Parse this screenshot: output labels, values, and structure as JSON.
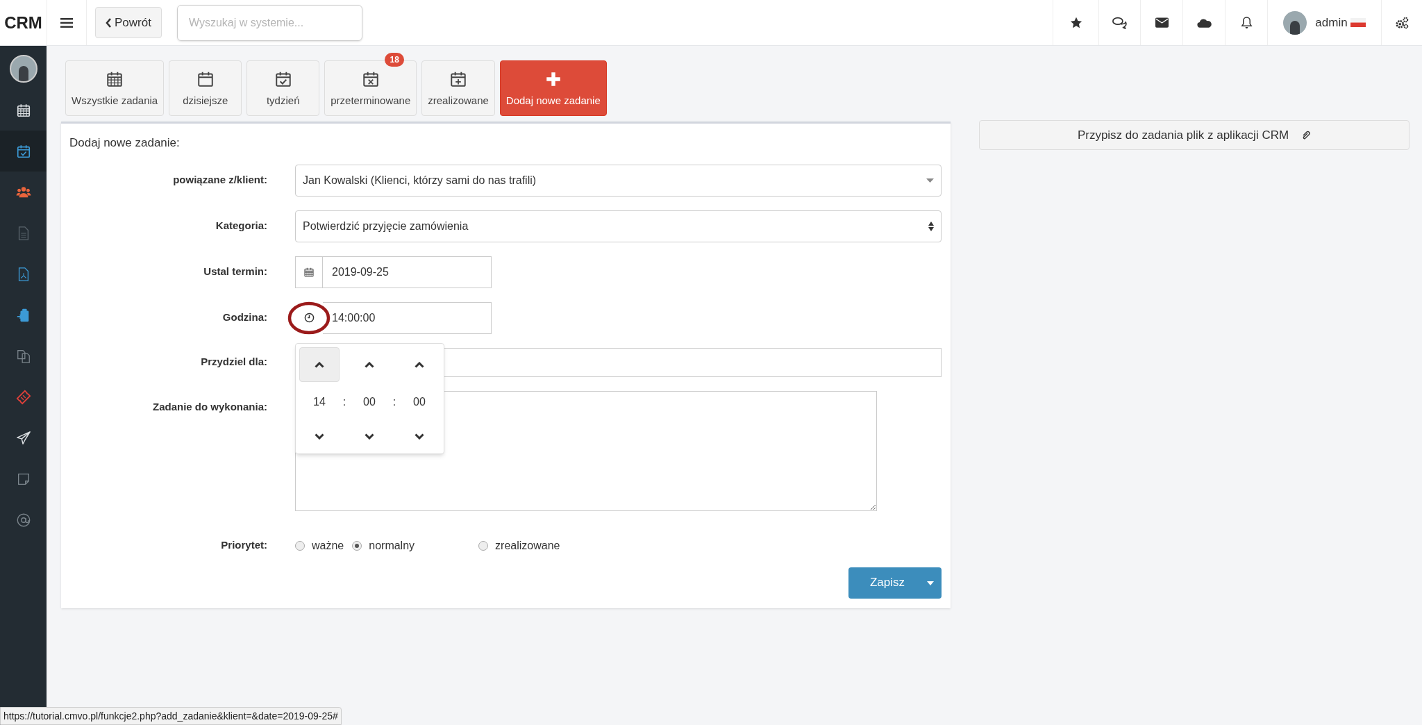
{
  "header": {
    "logo": "CRM",
    "back_button": "Powrót",
    "search": {
      "placeholder": "Wyszukaj w systemie..."
    },
    "user": {
      "name": "admin"
    }
  },
  "sidebar": {
    "items": [
      {
        "kind": "calendar-grid",
        "color": "#d9dde0",
        "selected": false
      },
      {
        "kind": "calendar-check",
        "color": "#3c9ad6",
        "selected": true
      },
      {
        "kind": "users",
        "color": "#e8643c",
        "selected": false
      },
      {
        "kind": "file",
        "color": "#59636b",
        "selected": false
      },
      {
        "kind": "pdf",
        "color": "#3c9ad6",
        "selected": false
      },
      {
        "kind": "clipboard",
        "color": "#3c9ad6",
        "selected": false
      },
      {
        "kind": "copy",
        "color": "#7b858c",
        "selected": false
      },
      {
        "kind": "ticket",
        "color": "#e0403a",
        "selected": false
      },
      {
        "kind": "plane",
        "color": "#d9dde0",
        "selected": false
      },
      {
        "kind": "note",
        "color": "#7b858c",
        "selected": false
      },
      {
        "kind": "at",
        "color": "#7b858c",
        "selected": false
      }
    ]
  },
  "tabs": [
    {
      "label": "Wszystkie zadania",
      "kind": "calendar-grid",
      "selected": false
    },
    {
      "label": "dzisiejsze",
      "kind": "calendar",
      "selected": false
    },
    {
      "label": "tydzień",
      "kind": "calendar-check",
      "selected": false
    },
    {
      "label": "przeterminowane",
      "kind": "calendar-x",
      "selected": false,
      "badge": "18"
    },
    {
      "label": "zrealizowane",
      "kind": "calendar-plus",
      "selected": false
    },
    {
      "label": "Dodaj nowe zadanie",
      "kind": "plus",
      "selected": true
    }
  ],
  "form": {
    "title": "Dodaj nowe zadanie:",
    "fields": [
      {
        "label": "powiązane z/klient:",
        "kind": "select",
        "value": "Jan Kowalski (Klienci, którzy sami do nas trafili)"
      },
      {
        "label": "Kategoria:",
        "kind": "spinner-select",
        "value": "Potwierdzić przyjęcie zamówienia"
      },
      {
        "label": "Ustal termin:",
        "kind": "date",
        "value": "2019-09-25"
      },
      {
        "label": "Godzina:",
        "kind": "time",
        "value": "14:00:00"
      },
      {
        "label": "Przydziel dla:",
        "kind": "text"
      },
      {
        "label": "Zadanie do wykonania:",
        "kind": "textarea"
      }
    ],
    "priority": {
      "label": "Priorytet:",
      "options": [
        {
          "label": "ważne",
          "selected": false
        },
        {
          "label": "normalny",
          "selected": true
        },
        {
          "label": "zrealizowane",
          "selected": false
        }
      ]
    },
    "save_button": "Zapisz"
  },
  "time_picker": {
    "values": [
      "14",
      "00",
      "00"
    ],
    "separators": [
      ":",
      ":"
    ]
  },
  "attach_button": "Przypisz do zadania plik z aplikacji CRM",
  "status_bar": "https://tutorial.cmvo.pl/funkcje2.php?add_zadanie&klient=&date=2019-09-25#"
}
